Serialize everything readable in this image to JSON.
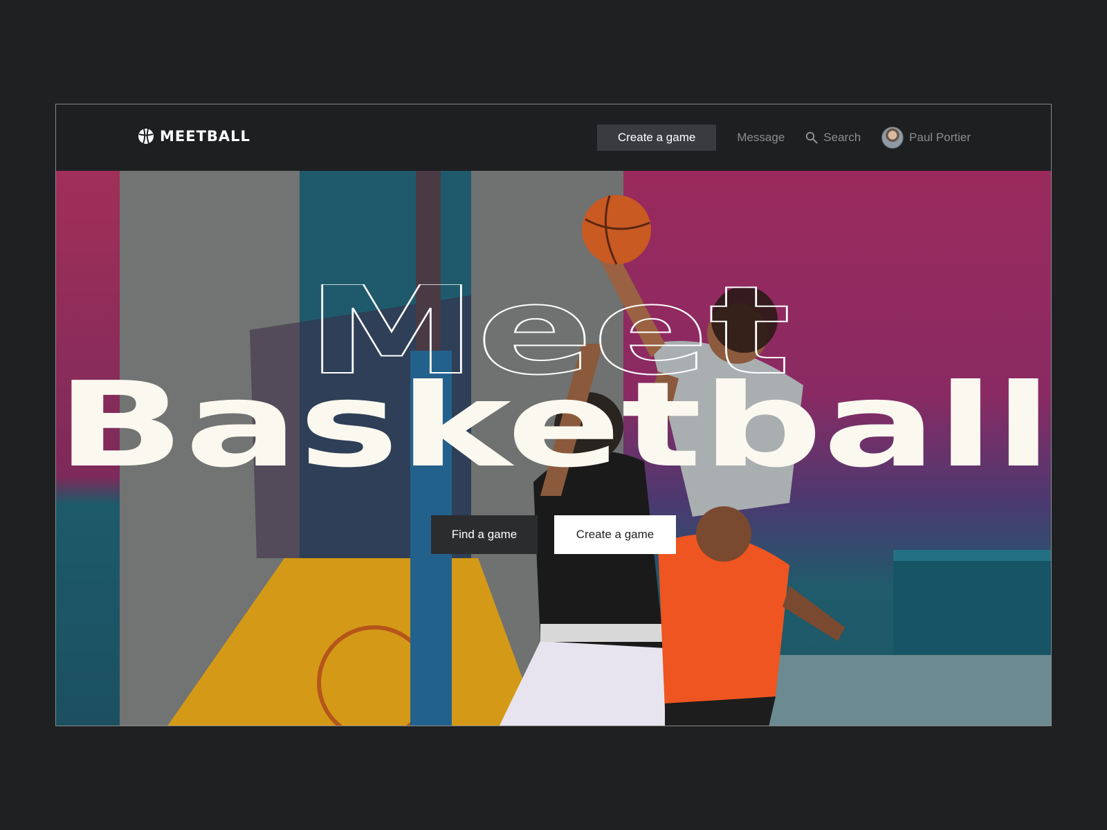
{
  "brand": {
    "name": "MEETBALL",
    "logo_icon": "basketball-icon"
  },
  "nav": {
    "create_label": "Create a game",
    "message_label": "Message",
    "search_label": "Search",
    "search_icon": "search-icon",
    "user_name": "Paul Portier"
  },
  "hero": {
    "title_outline": "Meet",
    "title_solid": "Basketball",
    "find_button": "Find a game",
    "create_button": "Create a game",
    "colors": {
      "magenta": "#9b2a5e",
      "teal": "#1f5b6b",
      "gray": "#6e716f",
      "yellow": "#d9a21a",
      "orange_shirt": "#f0561f"
    }
  }
}
